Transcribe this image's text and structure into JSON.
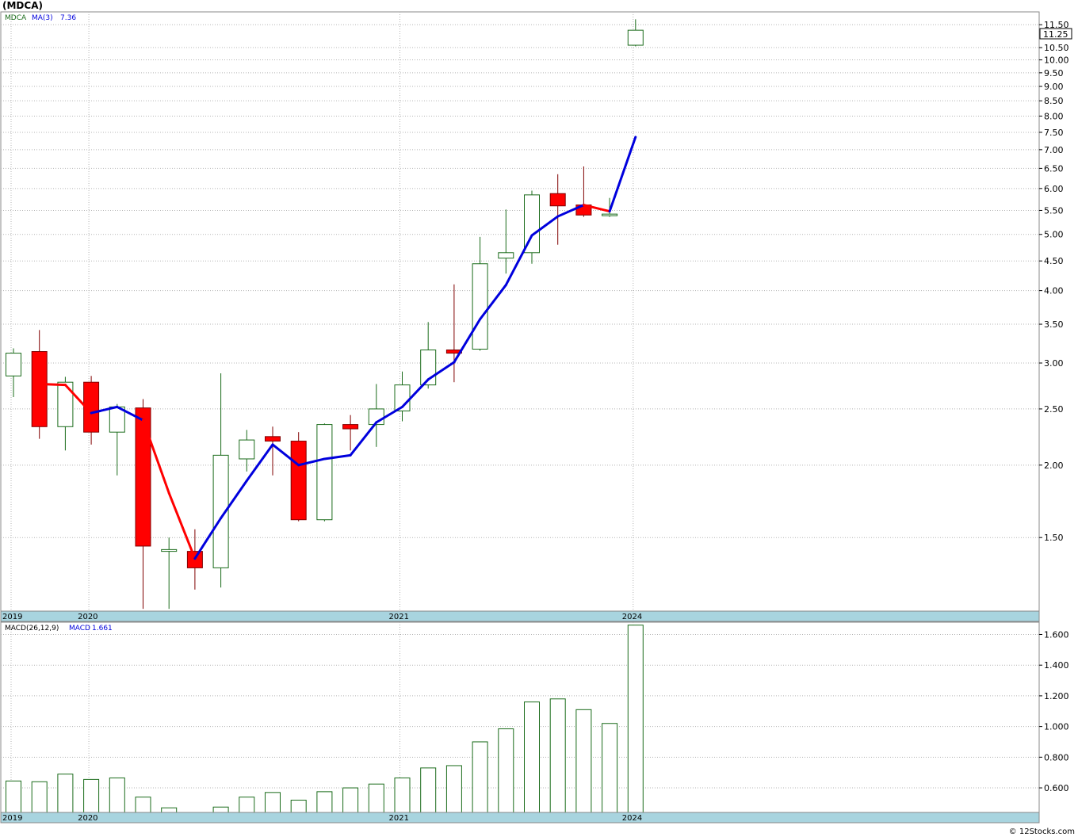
{
  "title": "(MDCA)",
  "footer": "© 12Stocks.com",
  "colors": {
    "up": "#1a6b1a",
    "down": "#ff0000",
    "ma_down": "#ff0000",
    "ma_up": "#0000dd",
    "macd_bar": "#1a6b1a",
    "axis_band": "#a8d4df"
  },
  "chart_data": [
    {
      "type": "candlestick",
      "legend": {
        "symbol": "MDCA",
        "ma_label": "MA(3)",
        "ma_value": "7.36"
      },
      "scale": "log",
      "ylim": [
        1.12,
        12.1
      ],
      "price_box": "11.25",
      "y_ticks": [
        "11.50",
        "10.50",
        "10.00",
        "9.50",
        "9.00",
        "8.50",
        "8.00",
        "7.50",
        "7.00",
        "6.50",
        "6.00",
        "5.50",
        "5.00",
        "4.50",
        "4.00",
        "3.50",
        "3.00",
        "2.50",
        "2.00",
        "1.50"
      ],
      "x_ticks": [
        {
          "label": "2019",
          "index": 0
        },
        {
          "label": "2020",
          "index": 3
        },
        {
          "label": "2021",
          "index": 15
        },
        {
          "label": "2024",
          "index": 24
        }
      ],
      "candles": [
        {
          "o": 2.85,
          "h": 3.18,
          "l": 2.62,
          "c": 3.12
        },
        {
          "o": 3.14,
          "h": 3.42,
          "l": 2.22,
          "c": 2.33
        },
        {
          "o": 2.33,
          "h": 2.84,
          "l": 2.12,
          "c": 2.78
        },
        {
          "o": 2.78,
          "h": 2.85,
          "l": 2.17,
          "c": 2.28
        },
        {
          "o": 2.28,
          "h": 2.55,
          "l": 1.92,
          "c": 2.52
        },
        {
          "o": 2.51,
          "h": 2.6,
          "l": 1.13,
          "c": 1.45
        },
        {
          "o": 1.42,
          "h": 1.5,
          "l": 1.13,
          "c": 1.43
        },
        {
          "o": 1.42,
          "h": 1.55,
          "l": 1.22,
          "c": 1.33
        },
        {
          "o": 1.33,
          "h": 2.88,
          "l": 1.23,
          "c": 2.08
        },
        {
          "o": 2.05,
          "h": 2.3,
          "l": 1.95,
          "c": 2.21
        },
        {
          "o": 2.24,
          "h": 2.33,
          "l": 1.92,
          "c": 2.2
        },
        {
          "o": 2.2,
          "h": 2.28,
          "l": 1.6,
          "c": 1.61
        },
        {
          "o": 1.61,
          "h": 2.36,
          "l": 1.6,
          "c": 2.35
        },
        {
          "o": 2.35,
          "h": 2.44,
          "l": 2.12,
          "c": 2.31
        },
        {
          "o": 2.35,
          "h": 2.76,
          "l": 2.15,
          "c": 2.5
        },
        {
          "o": 2.48,
          "h": 2.9,
          "l": 2.38,
          "c": 2.75
        },
        {
          "o": 2.75,
          "h": 3.53,
          "l": 2.71,
          "c": 3.16
        },
        {
          "o": 3.16,
          "h": 4.1,
          "l": 2.78,
          "c": 3.12
        },
        {
          "o": 3.17,
          "h": 4.95,
          "l": 3.15,
          "c": 4.45
        },
        {
          "o": 4.55,
          "h": 5.52,
          "l": 4.28,
          "c": 4.65
        },
        {
          "o": 4.65,
          "h": 5.95,
          "l": 4.45,
          "c": 5.85
        },
        {
          "o": 5.88,
          "h": 6.35,
          "l": 4.8,
          "c": 5.6
        },
        {
          "o": 5.62,
          "h": 6.55,
          "l": 5.36,
          "c": 5.4
        },
        {
          "o": 5.42,
          "h": 5.78,
          "l": 5.36,
          "c": 5.42
        },
        {
          "o": 10.6,
          "h": 11.75,
          "l": 10.55,
          "c": 11.25
        }
      ],
      "ma": [
        null,
        2.76,
        2.75,
        2.46,
        2.52,
        2.39,
        1.79,
        1.38,
        1.62,
        1.88,
        2.17,
        2.0,
        2.05,
        2.08,
        2.37,
        2.52,
        2.81,
        3.01,
        3.57,
        4.09,
        4.98,
        5.37,
        5.62,
        5.48,
        7.36
      ],
      "ma_colors": [
        "down",
        "down",
        "down",
        "up",
        "up",
        "down",
        "down",
        "up",
        "up",
        "up",
        "up",
        "up",
        "up",
        "up",
        "up",
        "up",
        "up",
        "up",
        "up",
        "up",
        "up",
        "up",
        "down",
        "up"
      ]
    },
    {
      "type": "bar",
      "legend": {
        "label": "MACD(26,12,9)",
        "macd_label": "MACD",
        "macd_value": "1.661"
      },
      "ylim": [
        0.44,
        1.68
      ],
      "y_ticks": [
        "1.600",
        "1.400",
        "1.200",
        "1.000",
        "0.800",
        "0.600"
      ],
      "x_ticks": [
        {
          "label": "2019",
          "index": 0
        },
        {
          "label": "2020",
          "index": 3
        },
        {
          "label": "2021",
          "index": 15
        },
        {
          "label": "2024",
          "index": 24
        }
      ],
      "values": [
        0.645,
        0.64,
        0.69,
        0.655,
        0.665,
        0.54,
        0.47,
        0.42,
        0.475,
        0.54,
        0.57,
        0.52,
        0.575,
        0.6,
        0.625,
        0.665,
        0.73,
        0.745,
        0.9,
        0.985,
        1.16,
        1.18,
        1.11,
        1.02,
        1.661
      ]
    }
  ]
}
